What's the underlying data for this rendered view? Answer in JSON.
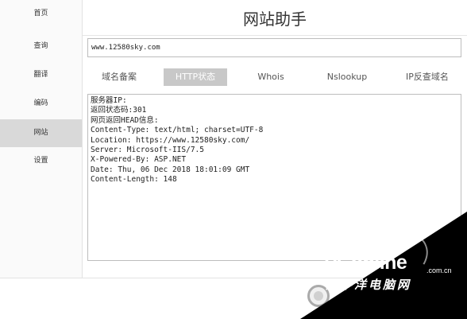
{
  "sidebar": {
    "items": [
      {
        "label": "首页"
      },
      {
        "label": "查询"
      },
      {
        "label": "翻译"
      },
      {
        "label": "编码"
      },
      {
        "label": "网站"
      },
      {
        "label": "设置"
      }
    ],
    "active_index": 4
  },
  "header": {
    "title": "网站助手"
  },
  "url_input": {
    "value": "www.12580sky.com"
  },
  "tabs": [
    {
      "label": "域名备案"
    },
    {
      "label": "HTTP状态"
    },
    {
      "label": "Whois"
    },
    {
      "label": "Nslookup"
    },
    {
      "label": "IP反查域名"
    }
  ],
  "active_tab_index": 1,
  "result": {
    "lines": [
      "服务器IP:",
      "返回状态码:301",
      "网页返回HEAD信息:",
      "Content-Type: text/html; charset=UTF-8",
      "Location: https://www.12580sky.com/",
      "Server: Microsoft-IIS/7.5",
      "X-Powered-By: ASP.NET",
      "Date: Thu, 06 Dec 2018 18:01:09 GMT",
      "Content-Length: 148"
    ]
  },
  "watermark": {
    "logo": "PConline",
    "domain": ".com.cn",
    "cn": "太平洋电脑网"
  },
  "colors": {
    "active_nav_bg": "#d9d9d9",
    "active_tab_bg": "#c8c8c8",
    "border": "#bdbdbd"
  }
}
